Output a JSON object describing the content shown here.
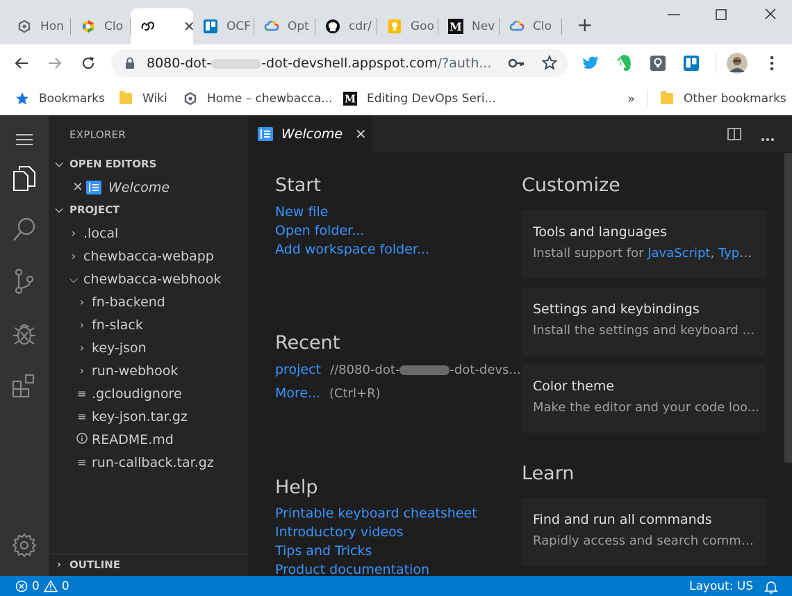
{
  "browser": {
    "tabs": [
      {
        "title": "Hon",
        "icon": "wordpress-icon"
      },
      {
        "title": "Clo",
        "icon": "google-cloud-icon"
      },
      {
        "title": "",
        "icon": "codeserver-icon",
        "active": true
      },
      {
        "title": "OCF",
        "icon": "trello-icon"
      },
      {
        "title": "Opt",
        "icon": "google-cloud-icon"
      },
      {
        "title": "cdr/",
        "icon": "github-icon"
      },
      {
        "title": "Goo",
        "icon": "lightbulb-icon"
      },
      {
        "title": "Nev",
        "icon": "medium-icon"
      },
      {
        "title": "Clo",
        "icon": "google-cloud-icon"
      }
    ],
    "new_tab_label": "+",
    "window_controls": {
      "minimize": "—",
      "maximize": "☐",
      "close": "✕"
    },
    "url": {
      "prefix": "8080-dot-",
      "suffix": "-dot-devshell.appspot.com",
      "rest": "/?auth..."
    },
    "bookmarks": [
      {
        "label": "Bookmarks",
        "icon": "star-icon"
      },
      {
        "label": "Wiki",
        "icon": "folder-icon"
      },
      {
        "label": "Home – chewbacca...",
        "icon": "wordpress-icon"
      },
      {
        "label": "Editing DevOps Seri...",
        "icon": "medium-icon"
      }
    ],
    "overflow_label": "»",
    "other_bookmarks": "Other bookmarks"
  },
  "sidebar": {
    "title": "EXPLORER",
    "open_editors_label": "OPEN EDITORS",
    "open_editor_item": "Welcome",
    "project_label": "PROJECT",
    "tree": [
      {
        "label": ".local",
        "type": "folder",
        "depth": 0
      },
      {
        "label": "chewbacca-webapp",
        "type": "folder",
        "depth": 0
      },
      {
        "label": "chewbacca-webhook",
        "type": "folder-open",
        "depth": 0
      },
      {
        "label": "fn-backend",
        "type": "folder",
        "depth": 1
      },
      {
        "label": "fn-slack",
        "type": "folder",
        "depth": 1
      },
      {
        "label": "key-json",
        "type": "folder",
        "depth": 1
      },
      {
        "label": "run-webhook",
        "type": "folder",
        "depth": 1
      },
      {
        "label": ".gcloudignore",
        "type": "file",
        "depth": 1
      },
      {
        "label": "key-json.tar.gz",
        "type": "file",
        "depth": 1
      },
      {
        "label": "README.md",
        "type": "info",
        "depth": 1
      },
      {
        "label": "run-callback.tar.gz",
        "type": "file",
        "depth": 1
      }
    ],
    "outline_label": "OUTLINE"
  },
  "editor": {
    "tab_label": "Welcome",
    "start": {
      "heading": "Start",
      "links": [
        "New file",
        "Open folder...",
        "Add workspace folder..."
      ]
    },
    "recent": {
      "heading": "Recent",
      "item_label": "project",
      "item_path_prefix": "//8080-dot-",
      "item_path_suffix": "-dot-devs...",
      "more_label": "More...",
      "more_shortcut": "(Ctrl+R)"
    },
    "help": {
      "heading": "Help",
      "links": [
        "Printable keyboard cheatsheet",
        "Introductory videos",
        "Tips and Tricks",
        "Product documentation"
      ]
    },
    "customize": {
      "heading": "Customize",
      "cards": [
        {
          "title": "Tools and languages",
          "desc_prefix": "Install support for ",
          "links": [
            "JavaScript",
            "TypeS..."
          ]
        },
        {
          "title": "Settings and keybindings",
          "desc": "Install the settings and keyboard sh..."
        },
        {
          "title": "Color theme",
          "desc": "Make the editor and your code loo..."
        }
      ]
    },
    "learn": {
      "heading": "Learn",
      "cards": [
        {
          "title": "Find and run all commands",
          "desc": "Rapidly access and search comman..."
        }
      ]
    }
  },
  "statusbar": {
    "errors": "0",
    "warnings": "0",
    "layout": "Layout: US"
  },
  "colors": {
    "accent": "#3794ff",
    "statusbar": "#007acc",
    "activitybar": "#333333",
    "sidebar": "#252526",
    "editor": "#1e1e1e"
  }
}
